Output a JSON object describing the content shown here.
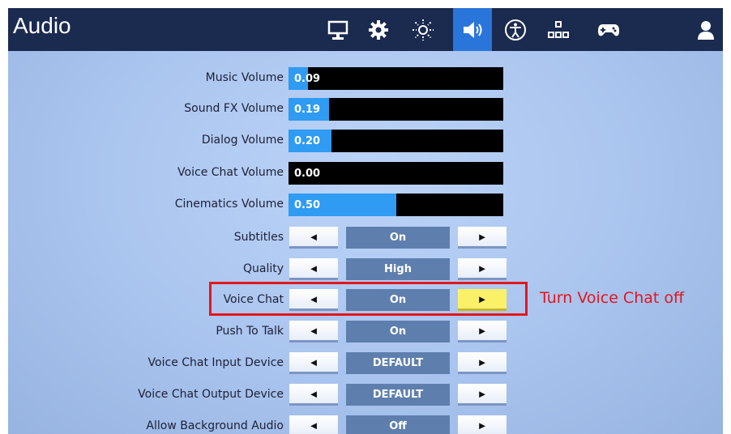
{
  "header": {
    "title": "Audio",
    "nav": [
      {
        "name": "monitor-icon"
      },
      {
        "name": "gear-icon"
      },
      {
        "name": "brightness-icon"
      },
      {
        "name": "speaker-icon",
        "active": true
      },
      {
        "name": "accessibility-icon"
      },
      {
        "name": "network-icon"
      },
      {
        "name": "gamepad-icon"
      },
      {
        "name": "account-icon"
      }
    ]
  },
  "sliders": [
    {
      "label": "Music Volume",
      "value": "0.09",
      "fraction": 0.09
    },
    {
      "label": "Sound FX Volume",
      "value": "0.19",
      "fraction": 0.19
    },
    {
      "label": "Dialog Volume",
      "value": "0.20",
      "fraction": 0.2
    },
    {
      "label": "Voice Chat Volume",
      "value": "0.00",
      "fraction": 0.0
    },
    {
      "label": "Cinematics Volume",
      "value": "0.50",
      "fraction": 0.5
    }
  ],
  "selectors": [
    {
      "label": "Subtitles",
      "value": "On"
    },
    {
      "label": "Quality",
      "value": "High"
    },
    {
      "label": "Voice Chat",
      "value": "On",
      "highlight_right": true
    },
    {
      "label": "Push To Talk",
      "value": "On"
    },
    {
      "label": "Voice Chat Input Device",
      "value": "DEFAULT"
    },
    {
      "label": "Voice Chat Output Device",
      "value": "DEFAULT"
    },
    {
      "label": "Allow Background Audio",
      "value": "Off"
    }
  ],
  "arrows": {
    "left": "◄",
    "right": "►"
  },
  "callout": {
    "text": "Turn Voice Chat off"
  },
  "colors": {
    "header_bg": "#1b2a4f",
    "active_tab": "#2a75d9",
    "slider_fill": "#2f9bf2",
    "value_box": "#5e7fae",
    "highlight": "#fbf168",
    "callout": "#e3161e"
  }
}
